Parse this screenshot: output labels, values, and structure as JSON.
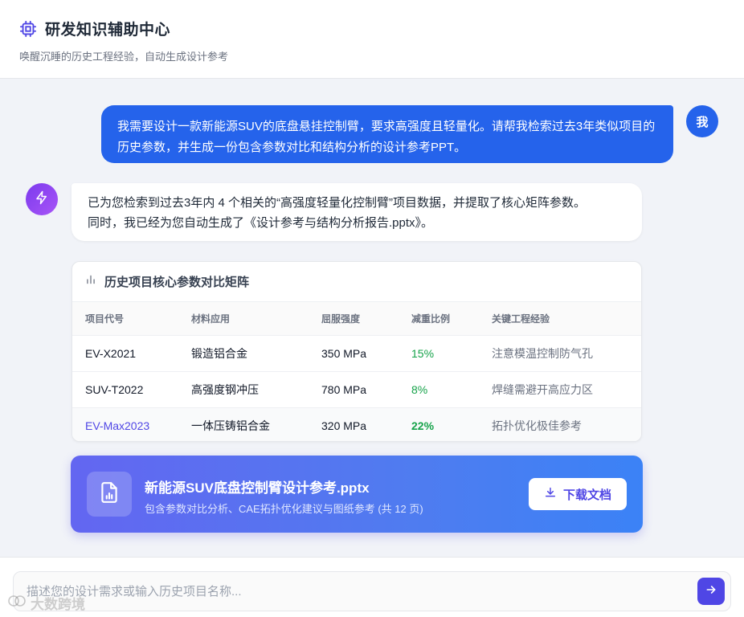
{
  "header": {
    "title": "研发知识辅助中心",
    "subtitle": "唤醒沉睡的历史工程经验，自动生成设计参考"
  },
  "user_message": {
    "text": "我需要设计一款新能源SUV的底盘悬挂控制臂，要求高强度且轻量化。请帮我检索过去3年类似项目的历史参数，并生成一份包含参数对比和结构分析的设计参考PPT。",
    "avatar": "我"
  },
  "bot_message": {
    "line1": "已为您检索到过去3年内 4 个相关的“高强度轻量化控制臂”项目数据，并提取了核心矩阵参数。",
    "line2": "同时，我已经为您自动生成了《设计参考与结构分析报告.pptx》。"
  },
  "matrix": {
    "title": "历史项目核心参数对比矩阵",
    "columns": [
      "项目代号",
      "材料应用",
      "屈服强度",
      "减重比例",
      "关键工程经验"
    ],
    "rows": [
      {
        "code": "EV-X2021",
        "material": "锻造铝合金",
        "strength": "350 MPa",
        "reduction": "15%",
        "experience": "注意模温控制防气孔"
      },
      {
        "code": "SUV-T2022",
        "material": "高强度钢冲压",
        "strength": "780 MPa",
        "reduction": "8%",
        "experience": "焊缝需避开高应力区"
      },
      {
        "code": "EV-Max2023",
        "material": "一体压铸铝合金",
        "strength": "320 MPa",
        "reduction": "22%",
        "experience": "拓扑优化极佳参考"
      }
    ]
  },
  "file": {
    "name": "新能源SUV底盘控制臂设计参考.pptx",
    "description": "包含参数对比分析、CAE拓扑优化建议与图纸参考 (共 12 页)",
    "download_label": "下载文档"
  },
  "input": {
    "placeholder": "描述您的设计需求或输入历史项目名称..."
  },
  "watermark": "大数跨境",
  "colors": {
    "primary": "#2563eb",
    "accent": "#4f46e5",
    "success": "#16a34a"
  }
}
